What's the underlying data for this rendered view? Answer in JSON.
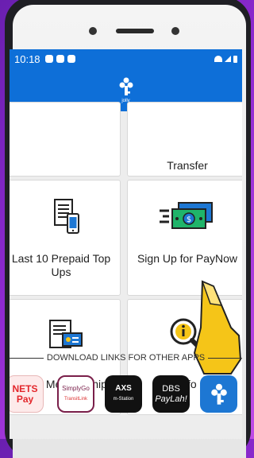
{
  "status_bar": {
    "time": "10:18"
  },
  "app_bar": {
    "logo_text": "jolly"
  },
  "tiles": {
    "transfer": "Transfer",
    "last_10": "Last 10  Prepaid Top Ups",
    "signup": "Sign Up for PayNow",
    "mwc": "MWC Membership",
    "info": "Info"
  },
  "download_section": {
    "title": "DOWNLOAD LINKS FOR OTHER APPS"
  },
  "apps": [
    {
      "name": "NETS Pay",
      "line1": "NETS",
      "line2": "Pay"
    },
    {
      "name": "SimplyGo",
      "line1": "SimplyGo",
      "line2": "TransitLink"
    },
    {
      "name": "AXS m-Station",
      "line1": "AXS",
      "line2": "m-Station"
    },
    {
      "name": "DBS PayLah!",
      "line1": "DBS",
      "line2": "PayLah!"
    },
    {
      "name": "jolly"
    }
  ],
  "colors": {
    "brand_blue": "#0e6fd8",
    "purple_bg": "#8e2ad0",
    "cash_green": "#1fb46a",
    "dollar_blue": "#1d77d3",
    "info_yellow": "#f5c518"
  }
}
